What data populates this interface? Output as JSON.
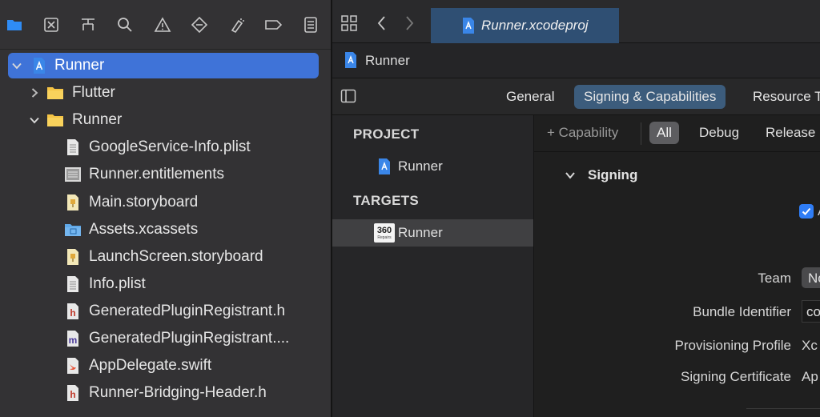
{
  "navigator": {
    "toolbar_icons": [
      "folder-icon",
      "source-control-icon",
      "symbol-icon",
      "search-icon",
      "warning-icon",
      "test-icon",
      "debug-icon",
      "breakpoint-icon",
      "report-icon"
    ],
    "tree": [
      {
        "label": "Runner",
        "icon": "xcode-project-icon",
        "depth": 0,
        "disclosure": "open",
        "selected": true
      },
      {
        "label": "Flutter",
        "icon": "folder-icon",
        "depth": 1,
        "disclosure": "closed"
      },
      {
        "label": "Runner",
        "icon": "folder-icon",
        "depth": 1,
        "disclosure": "open"
      },
      {
        "label": "GoogleService-Info.plist",
        "icon": "plist-file-icon",
        "depth": 2
      },
      {
        "label": "Runner.entitlements",
        "icon": "entitlements-file-icon",
        "depth": 2
      },
      {
        "label": "Main.storyboard",
        "icon": "storyboard-file-icon",
        "depth": 2
      },
      {
        "label": "Assets.xcassets",
        "icon": "asset-catalog-icon",
        "depth": 2
      },
      {
        "label": "LaunchScreen.storyboard",
        "icon": "storyboard-file-icon",
        "depth": 2
      },
      {
        "label": "Info.plist",
        "icon": "plist-file-icon",
        "depth": 2
      },
      {
        "label": "GeneratedPluginRegistrant.h",
        "icon": "header-file-icon",
        "depth": 2
      },
      {
        "label": "GeneratedPluginRegistrant....",
        "icon": "objc-file-icon",
        "depth": 2
      },
      {
        "label": "AppDelegate.swift",
        "icon": "swift-file-icon",
        "depth": 2
      },
      {
        "label": "Runner-Bridging-Header.h",
        "icon": "header-file-icon",
        "depth": 2
      }
    ]
  },
  "editor": {
    "tab": {
      "title": "Runner.xcodeproj"
    },
    "jumpbar": {
      "title": "Runner"
    },
    "segments": [
      "General",
      "Signing & Capabilities",
      "Resource T"
    ],
    "active_segment": 1,
    "project_header": "PROJECT",
    "project_item": "Runner",
    "targets_header": "TARGETS",
    "target_item": "Runner",
    "target_icon_text": "360",
    "target_icon_subtext": "Repairs",
    "capability_button": "+ Capability",
    "configs": [
      "All",
      "Debug",
      "Release"
    ],
    "active_config": 0,
    "signing": {
      "section_title": "Signing",
      "auto_checkbox_label": "A",
      "fields": [
        {
          "label": "Team",
          "value": "No"
        },
        {
          "label": "Bundle Identifier",
          "value": "co"
        },
        {
          "label": "Provisioning Profile",
          "value": "Xc"
        },
        {
          "label": "Signing Certificate",
          "value": "Ap"
        }
      ]
    }
  },
  "colors": {
    "selection_blue": "#3f73d8",
    "tab_active": "#2f4f73",
    "segment_active": "#3c5c7c",
    "checkbox_blue": "#2f7df6"
  }
}
